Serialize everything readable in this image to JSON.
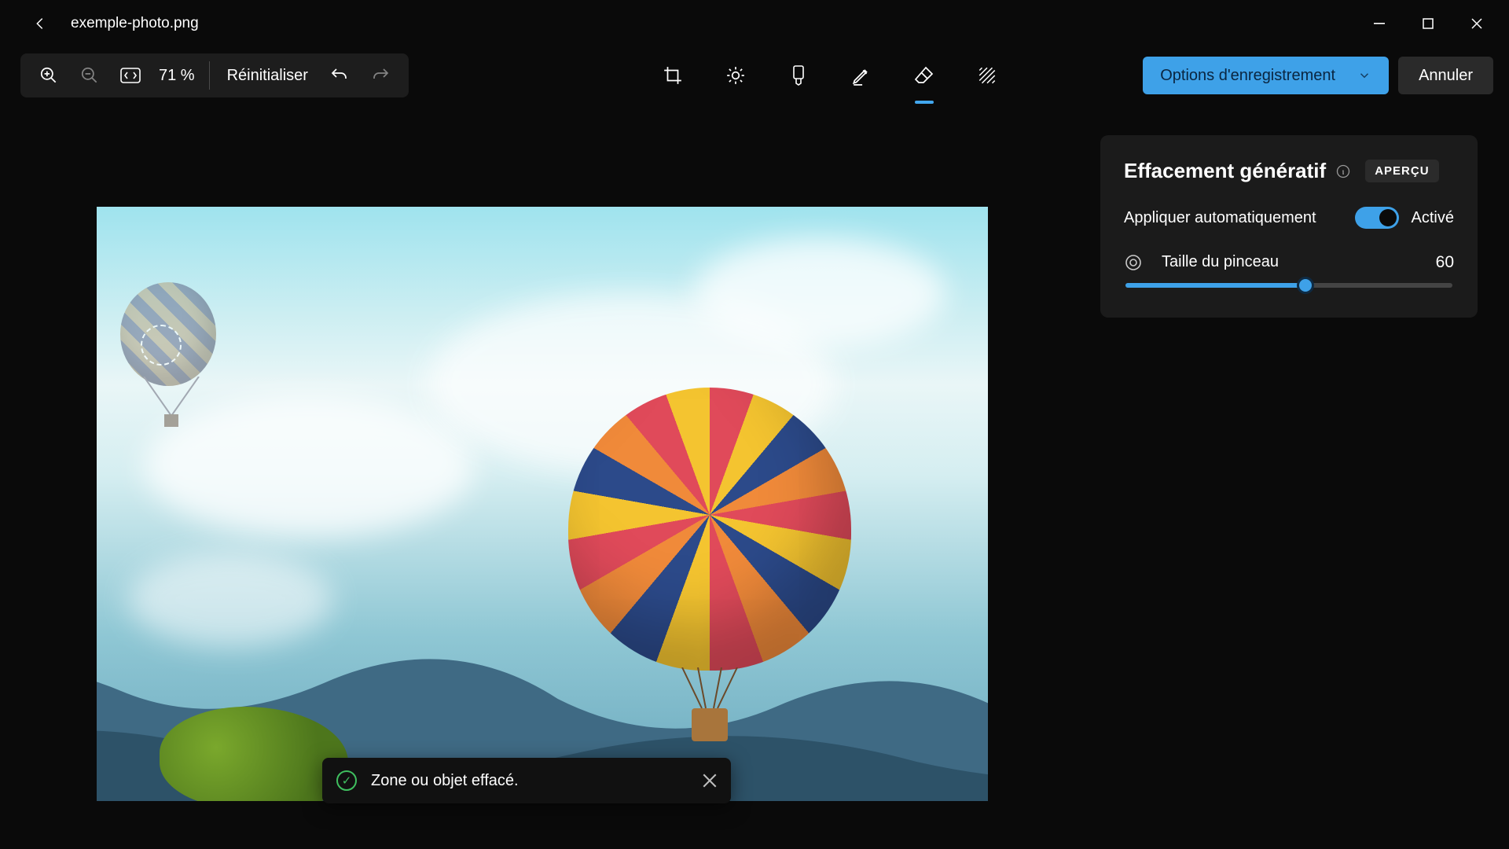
{
  "titlebar": {
    "file_name": "exemple-photo.png"
  },
  "toolbar": {
    "zoom_level": "71 %",
    "reset_label": "Réinitialiser",
    "save_options_label": "Options d'enregistrement",
    "cancel_label": "Annuler"
  },
  "panel": {
    "title": "Effacement génératif",
    "preview_badge": "APERÇU",
    "auto_apply_label": "Appliquer automatiquement",
    "auto_apply_state": "Activé",
    "brush_size_label": "Taille du pinceau",
    "brush_size_value": "60"
  },
  "toast": {
    "message": "Zone ou objet effacé."
  }
}
